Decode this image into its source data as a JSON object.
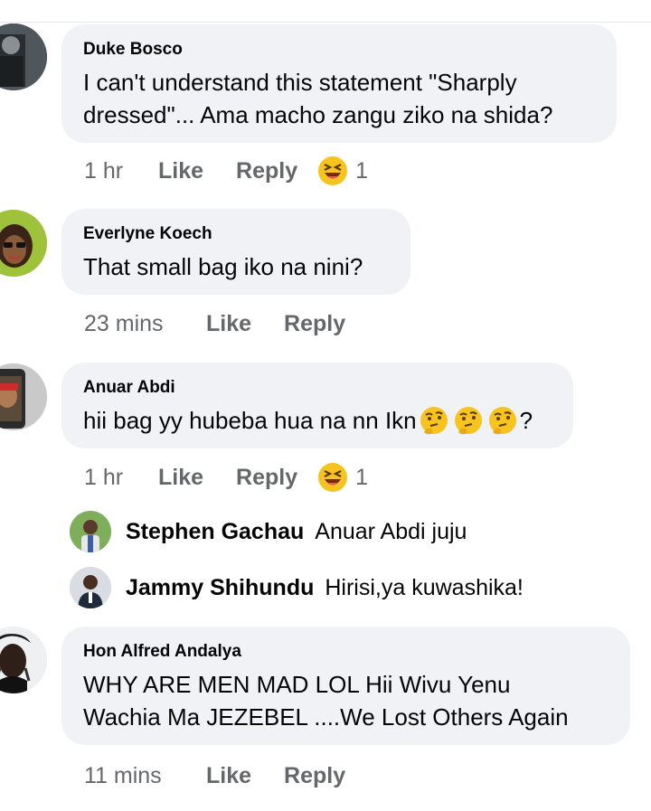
{
  "comments": [
    {
      "author": "Duke Bosco",
      "text_lines": [
        "I can't understand this statement \"Sharply",
        "dressed\"... Ama macho zangu ziko na shida?"
      ],
      "time": "1 hr",
      "like": "Like",
      "reply": "Reply",
      "reaction": {
        "icon": "laughing-squint-emoji-icon",
        "count": "1"
      }
    },
    {
      "author": "Everlyne Koech",
      "text_lines": [
        "That small bag iko na nini?"
      ],
      "time": "23 mins",
      "like": "Like",
      "reply": "Reply"
    },
    {
      "author": "Anuar Abdi",
      "text": "hii bag yy hubeba hua na nn Ikn",
      "text_suffix": "?",
      "emoji": "thinking-face-emoji-icon",
      "time": "1 hr",
      "like": "Like",
      "reply": "Reply",
      "reaction": {
        "icon": "laughing-squint-emoji-icon",
        "count": "1"
      },
      "replies": [
        {
          "author": "Stephen Gachau",
          "text": "Anuar Abdi juju"
        },
        {
          "author": "Jammy Shihundu",
          "text": "Hirisi,ya kuwashika!"
        }
      ]
    },
    {
      "author": "Hon Alfred Andalya",
      "text_lines": [
        "WHY ARE MEN MAD LOL Hii Wivu Yenu",
        "Wachia Ma JEZEBEL ....We Lost Others Again"
      ],
      "time": "11 mins",
      "like": "Like",
      "reply": "Reply"
    }
  ],
  "colors": {
    "bubble": "#f0f2f5",
    "meta": "#65676b",
    "text": "#050505",
    "emoji_yellow": "#f7c31e"
  }
}
